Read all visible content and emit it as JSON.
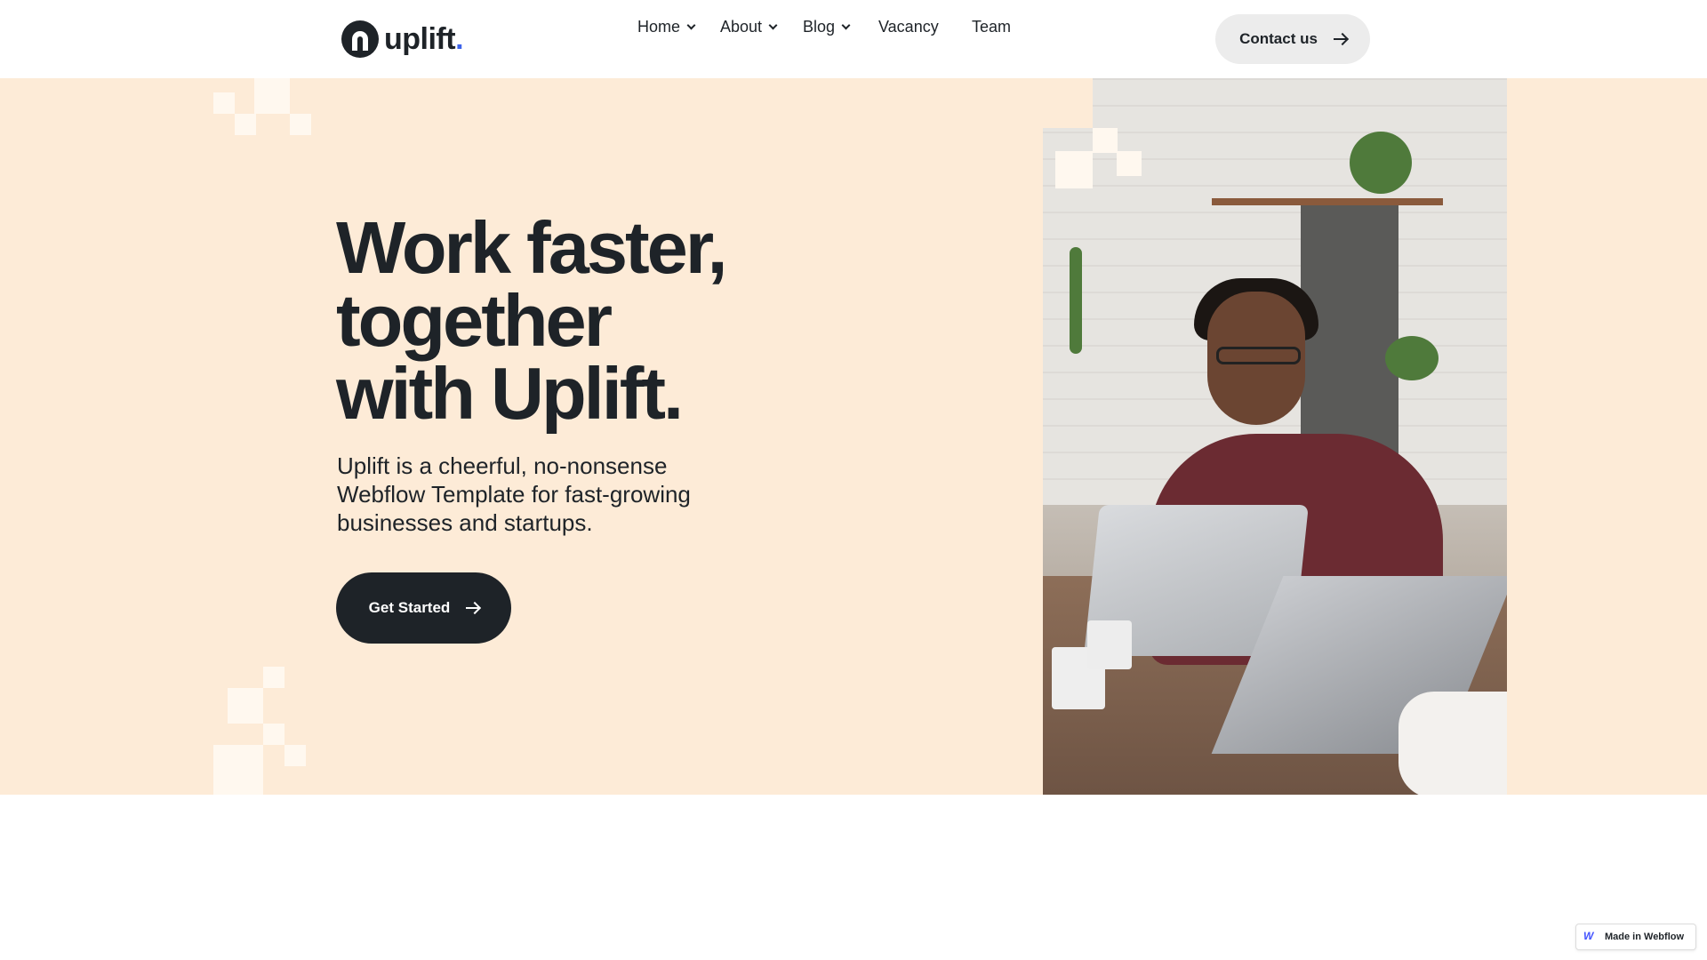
{
  "header": {
    "logo_text": "uplift",
    "logo_dot": ".",
    "nav": {
      "home": "Home",
      "about": "About",
      "blog": "Blog",
      "vacancy": "Vacancy",
      "team": "Team"
    },
    "contact_label": "Contact us"
  },
  "hero": {
    "title_line1": "Work faster,",
    "title_line2": "together",
    "title_line3": "with Uplift.",
    "subtitle": "Uplift is a cheerful, no-nonsense Webflow Template for fast-growing businesses and startups.",
    "cta_label": "Get Started"
  },
  "badge": {
    "label": "Made in Webflow"
  },
  "colors": {
    "hero_bg": "#fdebd7",
    "dark": "#1e2328",
    "contact_bg": "#ececec",
    "logo_accent": "#3d63ea",
    "pixel": "#fff8ef"
  },
  "icons": {
    "logo": "uplift-logo-mark",
    "chevron": "chevron-down-icon",
    "arrow": "arrow-right-icon",
    "webflow": "webflow-icon"
  }
}
